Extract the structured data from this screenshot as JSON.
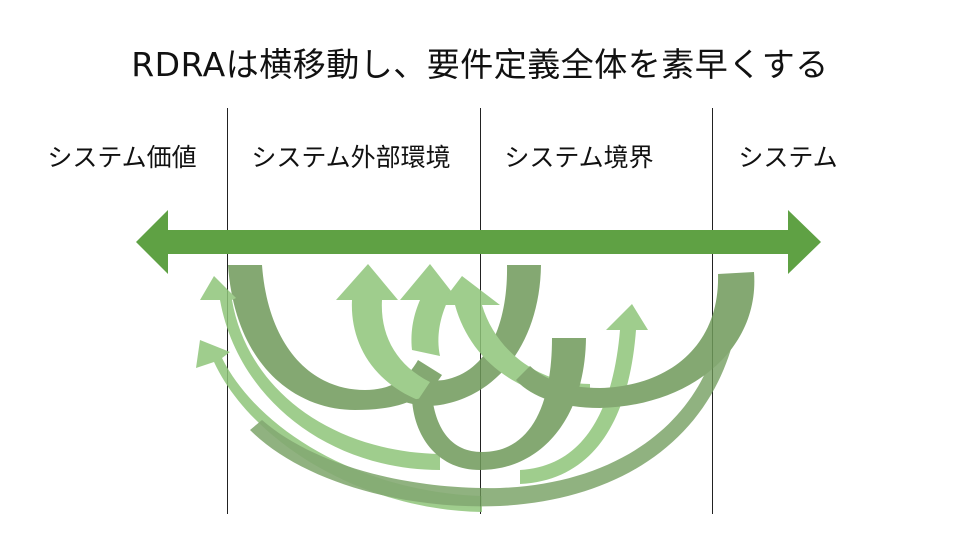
{
  "title": "RDRAは横移動し、要件定義全体を素早くする",
  "columns": [
    "システム価値",
    "システム外部環境",
    "システム境界",
    "システム"
  ],
  "colors": {
    "main_arrow": "#5fa144",
    "dark_arrow": "#6f9a5a",
    "light_arrow": "#8fc57a"
  }
}
